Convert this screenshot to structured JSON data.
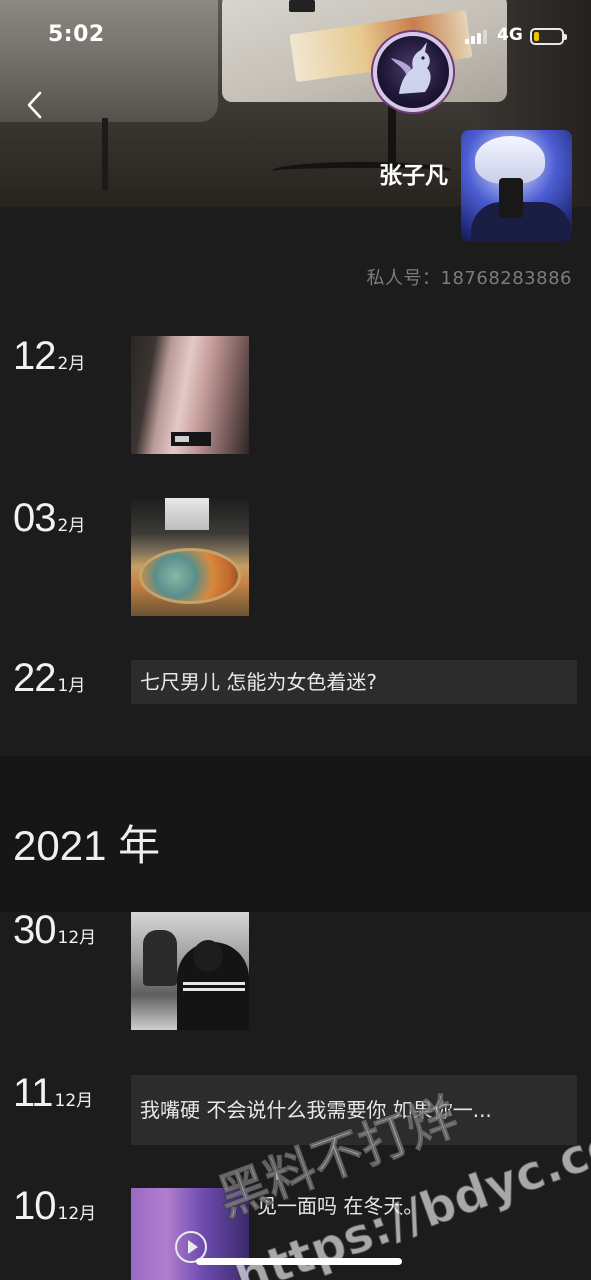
{
  "status_bar": {
    "time": "5:02",
    "network": "4G",
    "battery_level": 0.2
  },
  "header": {
    "back_icon": "chevron-left-icon",
    "badge_icon": "unicorn-logo-icon",
    "profile_name": "张子凡",
    "private_number": "私人号：18768283886"
  },
  "feed": {
    "entries_2022": [
      {
        "day": "12",
        "month": "2月",
        "type": "photo"
      },
      {
        "day": "03",
        "month": "2月",
        "type": "photo"
      },
      {
        "day": "22",
        "month": "1月",
        "type": "text",
        "text": "七尺男儿 怎能为女色着迷?"
      }
    ],
    "year_2021": "2021 年",
    "entries_2021": [
      {
        "day": "30",
        "month": "12月",
        "type": "photo"
      },
      {
        "day": "11",
        "month": "12月",
        "type": "text",
        "text": "我嘴硬 不会说什么我需要你 如果你一..."
      },
      {
        "day": "10",
        "month": "12月",
        "type": "video",
        "text": "见一面吗 在冬天。"
      }
    ]
  },
  "watermark": {
    "line1": "黑料不打烊",
    "line2": "https://bdyc.co"
  },
  "colors": {
    "background": "#1c1c1c",
    "card": "#2c2c2c",
    "year_band": "#161616",
    "muted_text": "#7c7c7c"
  }
}
